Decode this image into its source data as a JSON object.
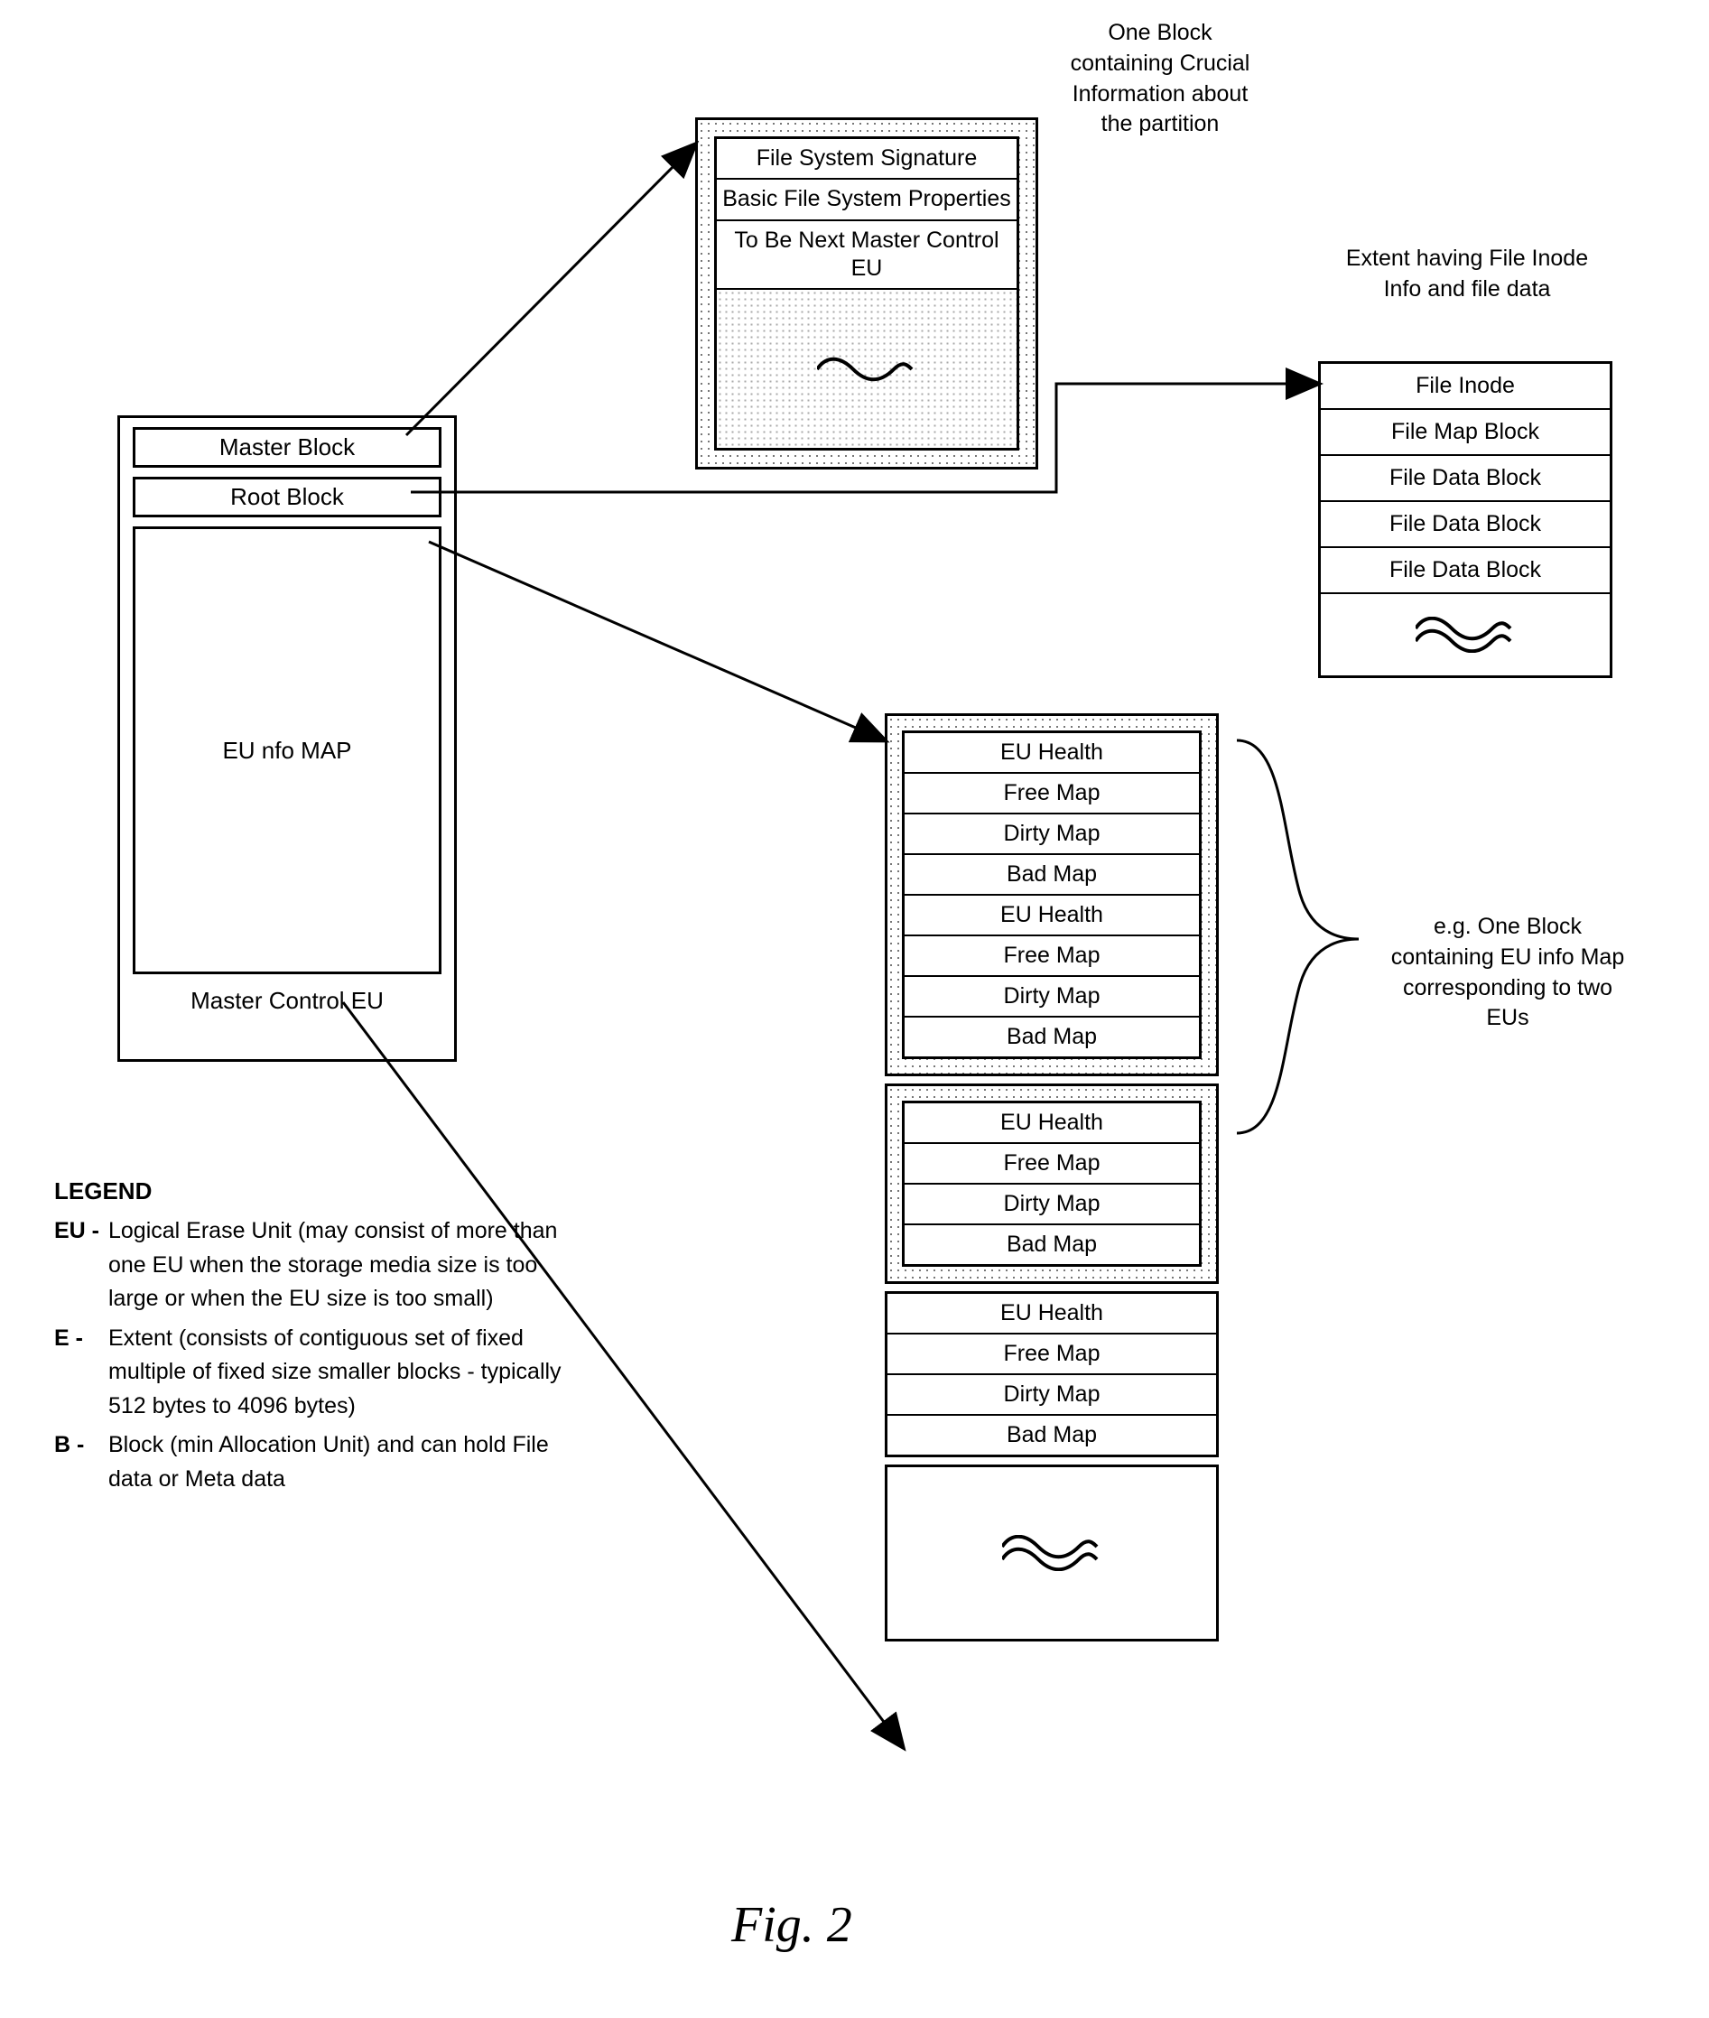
{
  "master_control": {
    "row0": "Master Block",
    "row1": "Root Block",
    "map_label": "EU nfo MAP",
    "caption": "Master Control EU"
  },
  "master_block_detail": {
    "cell0": "File System Signature",
    "cell1": "Basic File System Properties",
    "cell2": "To Be Next Master Control EU",
    "annotation": "One Block containing Crucial Information about the partition"
  },
  "extent": {
    "annotation": "Extent having File Inode Info and file data",
    "rows": [
      "File Inode",
      "File Map Block",
      "File Data Block",
      "File Data Block",
      "File Data Block"
    ]
  },
  "eu_info_map": {
    "block0_rows": [
      "EU Health",
      "Free Map",
      "Dirty Map",
      "Bad Map",
      "EU Health",
      "Free Map",
      "Dirty Map",
      "Bad Map"
    ],
    "block1_rows": [
      "EU Health",
      "Free Map",
      "Dirty Map",
      "Bad Map"
    ],
    "block2_rows": [
      "EU Health",
      "Free Map",
      "Dirty Map",
      "Bad Map"
    ],
    "annotation": "e.g. One Block containing EU info Map corresponding to two EUs"
  },
  "legend": {
    "title": "LEGEND",
    "items": [
      {
        "key": "EU -",
        "text": "Logical Erase Unit (may consist of more than one EU when the storage media size is too large or when the EU size is too small)"
      },
      {
        "key": "E -",
        "text": "Extent (consists of contiguous set of fixed multiple of fixed size smaller blocks - typically 512 bytes to 4096 bytes)"
      },
      {
        "key": "B -",
        "text": "Block (min Allocation Unit) and can hold File data or Meta data"
      }
    ]
  },
  "fig_caption": "Fig. 2"
}
